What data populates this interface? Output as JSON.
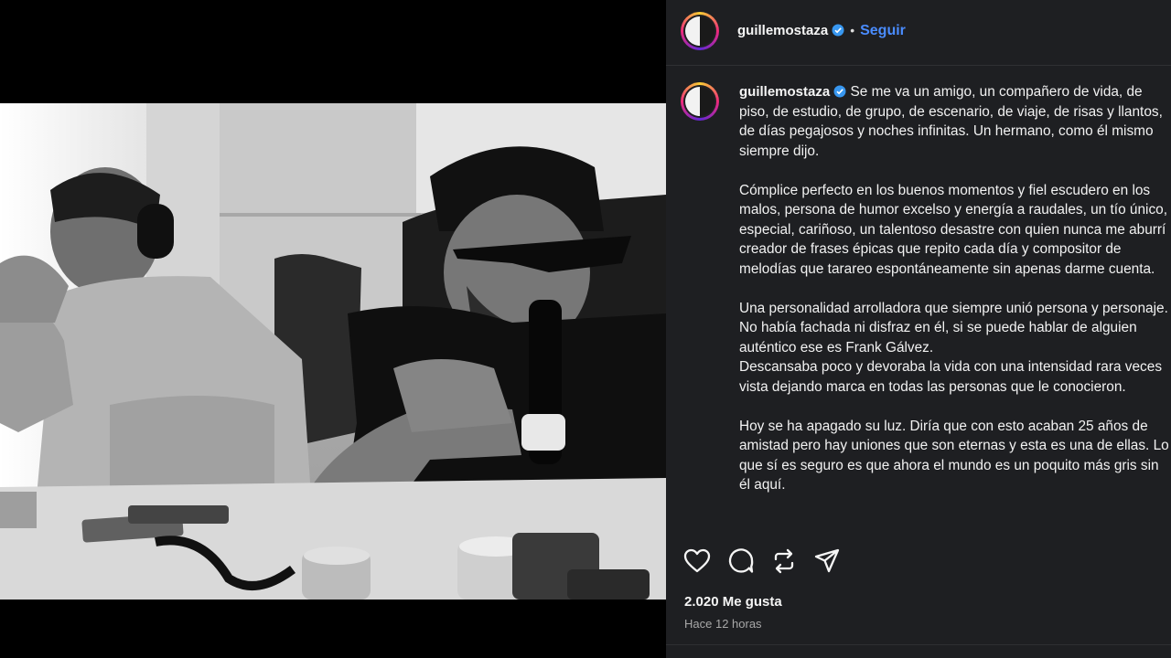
{
  "post": {
    "username": "guillemostaza",
    "follow_label": "Seguir",
    "separator": "•",
    "caption": [
      "Se me va un amigo, un compañero de vida, de piso, de estudio, de grupo, de escenario, de viaje, de risas y llantos, de días pegajosos y noches infinitas. Un hermano, como él mismo siempre dijo.",
      "Cómplice perfecto en los buenos momentos y fiel escudero en los malos, persona de humor excelso y energía a raudales, un tío único, especial, cariñoso, un talentoso desastre con quien nunca me aburrí creador de frases épicas que repito cada día y compositor de melodías que tarareo espontáneamente sin apenas darme cuenta.",
      "Una personalidad arrolladora que siempre unió persona y personaje. No había fachada ni disfraz en él, si se puede hablar de alguien auténtico ese es Frank Gálvez.",
      "Descansaba poco y devoraba la vida con una intensidad rara veces vista dejando marca en todas las personas que le conocieron.",
      "Hoy se ha apagado su luz. Diría que con esto acaban 25 años de amistad pero hay uniones que son eternas y esta es una de ellas. Lo que sí es seguro es que ahora el mundo es un poquito más gris sin él aquí."
    ],
    "likes": "2.020 Me gusta",
    "time": "Hace 12 horas"
  },
  "colors": {
    "follow": "#4a8cff",
    "verified": "#3897f0",
    "panel_bg": "#1e1f22"
  },
  "icons": [
    "heart-icon",
    "comment-icon",
    "repost-icon",
    "share-icon",
    "verified-icon"
  ]
}
